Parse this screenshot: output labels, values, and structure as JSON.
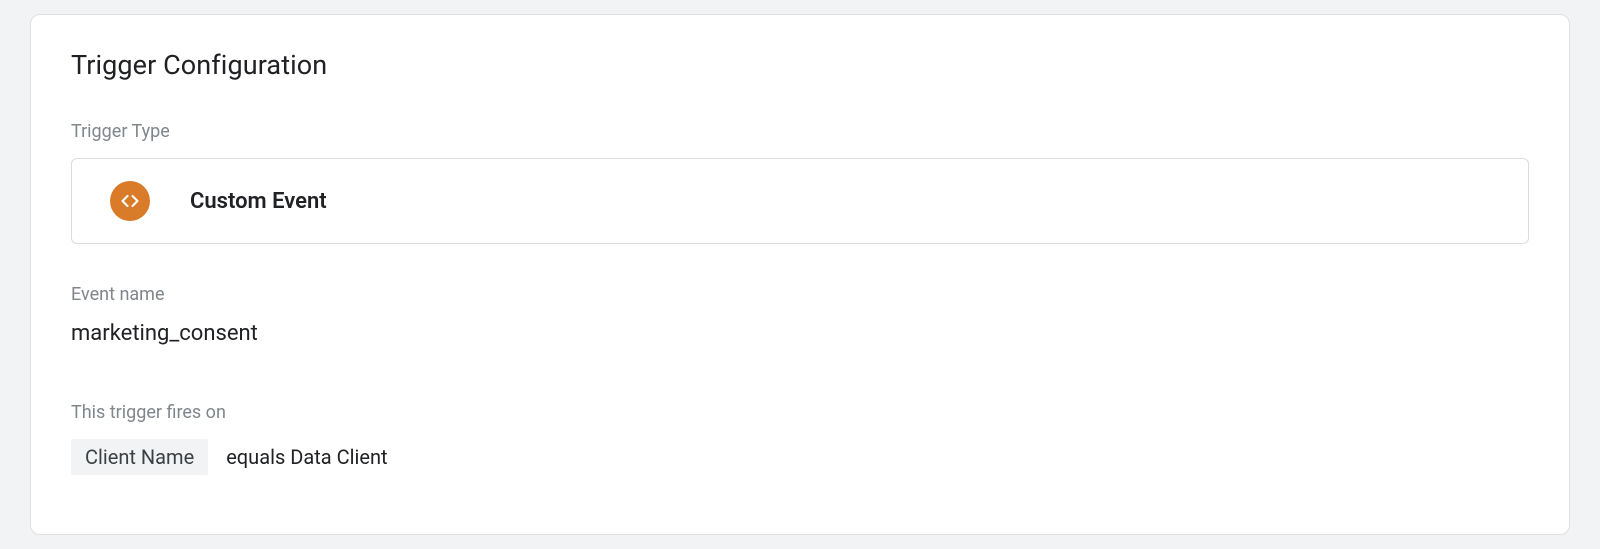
{
  "card": {
    "title": "Trigger Configuration"
  },
  "triggerType": {
    "label": "Trigger Type",
    "name": "Custom Event",
    "iconColor": "#d97b29"
  },
  "eventName": {
    "label": "Event name",
    "value": "marketing_consent"
  },
  "firesOn": {
    "label": "This trigger fires on",
    "condition": {
      "variable": "Client Name",
      "operatorAndValue": "equals Data Client"
    }
  }
}
